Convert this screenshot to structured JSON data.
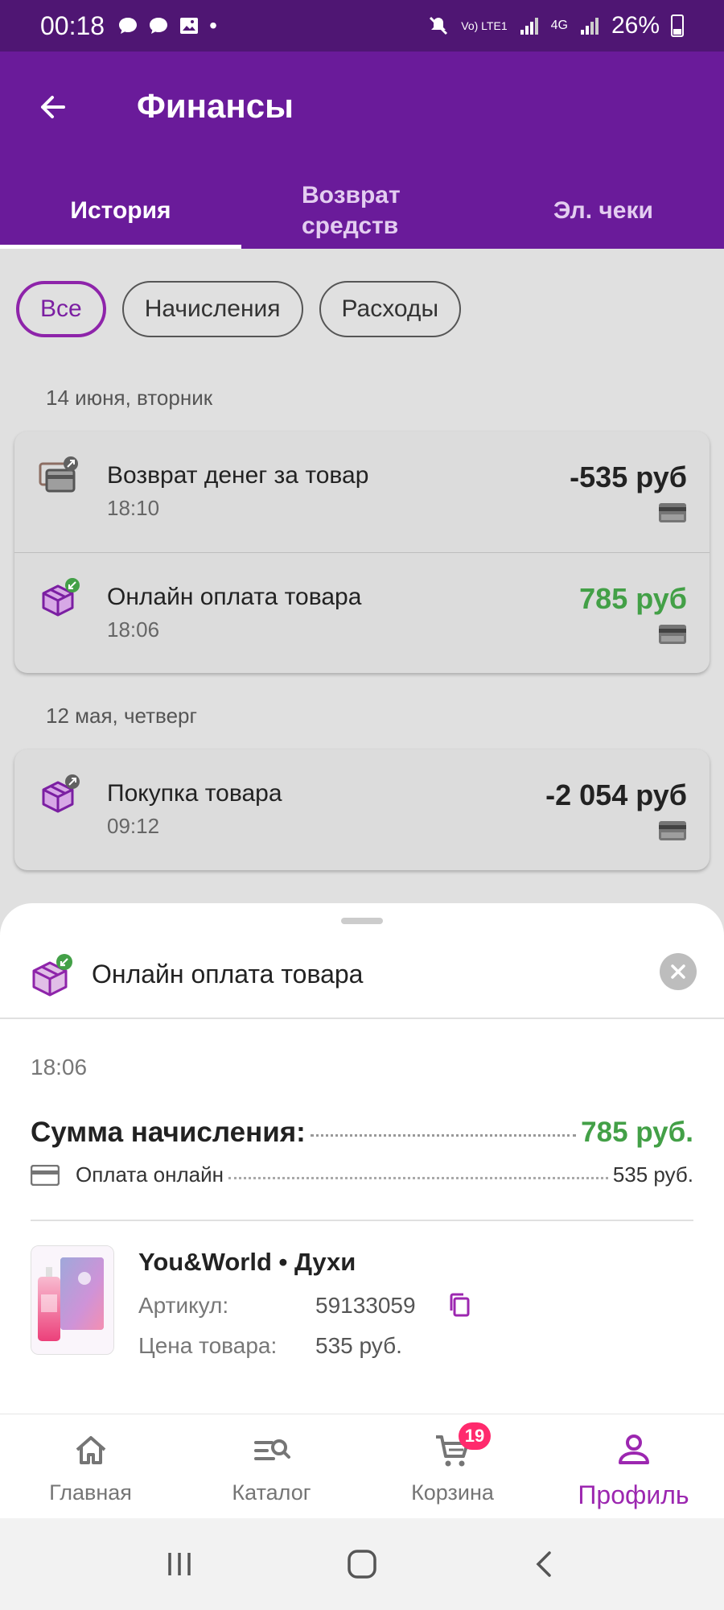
{
  "status_bar": {
    "time": "00:18",
    "network": "Vo) LTE1",
    "network_type": "4G",
    "battery": "26%"
  },
  "header": {
    "title": "Финансы",
    "tabs": [
      {
        "label": "История",
        "active": true
      },
      {
        "label": "Возврат средств",
        "active": false
      },
      {
        "label": "Эл. чеки",
        "active": false
      }
    ]
  },
  "filters": [
    {
      "label": "Все",
      "active": true
    },
    {
      "label": "Начисления",
      "active": false
    },
    {
      "label": "Расходы",
      "active": false
    }
  ],
  "groups": [
    {
      "date": "14 июня, вторник",
      "items": [
        {
          "name": "Возврат денег за товар",
          "time": "18:10",
          "amount": "-535 руб",
          "icon": "refund-card-icon"
        },
        {
          "name": "Онлайн оплата товара",
          "time": "18:06",
          "amount": "785 руб",
          "icon": "box-incoming-icon"
        }
      ]
    },
    {
      "date": "12 мая, четверг",
      "items": [
        {
          "name": "Покупка товара",
          "time": "09:12",
          "amount": "-2 054 руб",
          "icon": "box-outgoing-icon"
        }
      ]
    }
  ],
  "sheet": {
    "title": "Онлайн оплата товара",
    "time": "18:06",
    "sum_label": "Сумма начисления:",
    "sum_value": "785 руб.",
    "payment_label": "Оплата онлайн",
    "payment_value": "535 руб.",
    "product": {
      "name": "You&World • Духи",
      "article_label": "Артикул:",
      "article_value": "59133059",
      "price_label": "Цена товара:",
      "price_value": "535 руб."
    }
  },
  "bottom_nav": [
    {
      "label": "Главная",
      "icon": "home-icon",
      "active": false
    },
    {
      "label": "Каталог",
      "icon": "catalog-search-icon",
      "active": false
    },
    {
      "label": "Корзина",
      "icon": "cart-icon",
      "active": false,
      "badge": "19"
    },
    {
      "label": "Профиль",
      "icon": "profile-icon",
      "active": true
    }
  ],
  "colors": {
    "primary": "#6a1b9a",
    "status_bar": "#4f1673",
    "accent": "#9c27b0",
    "positive": "#43a047",
    "badge": "#ff2a6d"
  }
}
